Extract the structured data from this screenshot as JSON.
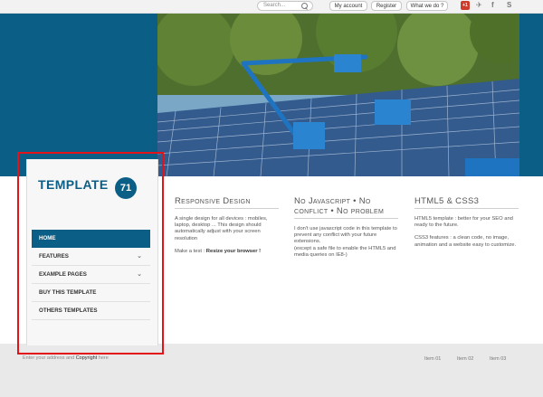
{
  "topbar": {
    "search_placeholder": "Search...",
    "buttons": [
      "My account",
      "Register",
      "What we do ?"
    ],
    "rss_label": "+1",
    "social": [
      "twitter",
      "facebook",
      "skype"
    ]
  },
  "sidebar": {
    "logo_text": "TEMPLATE",
    "logo_number": "71",
    "nav": [
      {
        "label": "HOME",
        "active": true,
        "has_submenu": false
      },
      {
        "label": "FEATURES",
        "active": false,
        "has_submenu": true
      },
      {
        "label": "EXAMPLE PAGES",
        "active": false,
        "has_submenu": true
      },
      {
        "label": "BUY THIS TEMPLATE",
        "active": false,
        "has_submenu": false
      },
      {
        "label": "OTHERS TEMPLATES",
        "active": false,
        "has_submenu": false
      }
    ]
  },
  "columns": [
    {
      "title": "Responsive Design",
      "p1": "A single design for all devices : mobiles, laptop, desktop ... This design should automatically adjust with your screen resolution",
      "p2_prefix": "Make a test : ",
      "p2_bold": "Resize your browser !"
    },
    {
      "title": "No Javascript • No conflict • No problem",
      "p1": "I don't use javascript code in this template to prevent any conflict with your future extensions.",
      "p2": "(except a safe file to enable the HTML5 and media queries on IE8-)"
    },
    {
      "title": "HTML5 & CSS3",
      "p1": "HTML5 template : better for your SEO and ready to the future.",
      "p2": "CSS3 features : a clean code, no image, animation and a website easy to customize."
    }
  ],
  "footer": {
    "prefix": "Enter your address and ",
    "copyright": "Copyright",
    "suffix": " here",
    "items": [
      "Item 01",
      "Item 02",
      "Item 03"
    ]
  },
  "colors": {
    "brand_blue": "#0b5f86",
    "selection_red": "#e2141a"
  }
}
